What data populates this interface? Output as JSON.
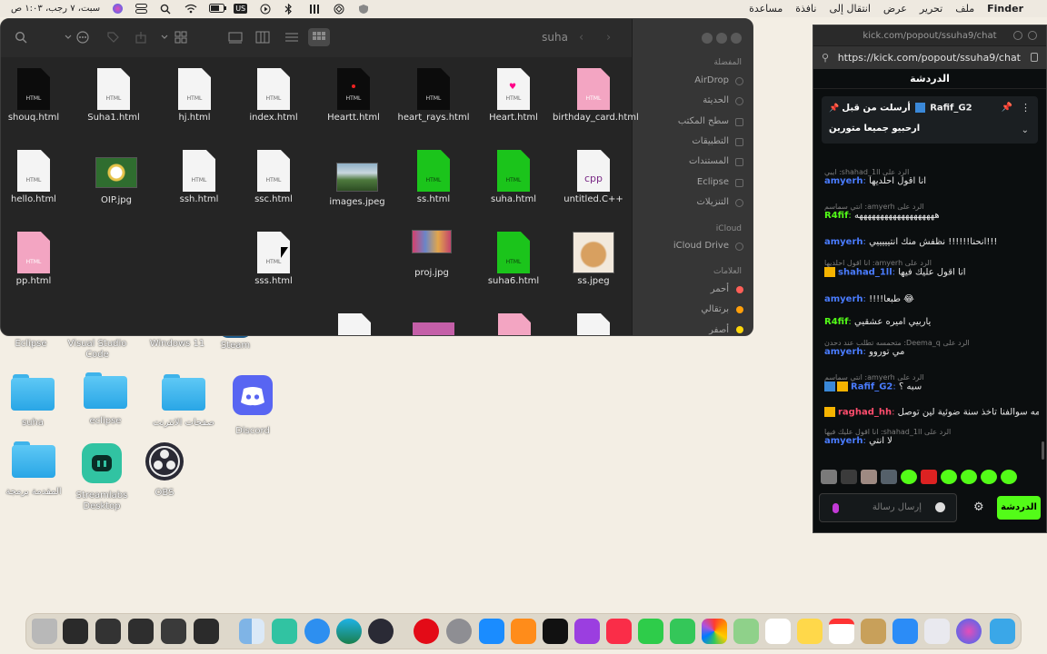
{
  "menubar": {
    "apple": "",
    "items": [
      "Finder",
      "ملف",
      "تحرير",
      "عرض",
      "انتقال إلى",
      "نافذة",
      "مساعدة"
    ],
    "clock": "سبت، ٧ رجب، ١:٠٣ ص",
    "us_badge": "US"
  },
  "desktop": {
    "items": [
      {
        "label": "Eclipse"
      },
      {
        "label": "Visual Studio Code"
      },
      {
        "label": "Windows 11"
      },
      {
        "label": "Steam"
      },
      {
        "label": "suha"
      },
      {
        "label": "eclipse"
      },
      {
        "label": "صفحات الانترنت"
      },
      {
        "label": "Discord"
      },
      {
        "label": "المقدمة برمجة"
      },
      {
        "label": "Streamlabs Desktop"
      },
      {
        "label": "OBS"
      }
    ]
  },
  "finder": {
    "title": "suha",
    "files": [
      {
        "name": "shouq.html",
        "kind": "doc",
        "tag": "HTML",
        "color": "black"
      },
      {
        "name": "Suha1.html",
        "kind": "doc",
        "tag": "HTML",
        "color": "white"
      },
      {
        "name": "hj.html",
        "kind": "doc",
        "tag": "HTML",
        "color": "white"
      },
      {
        "name": "index.html",
        "kind": "doc",
        "tag": "HTML",
        "color": "white"
      },
      {
        "name": "Heartt.html",
        "kind": "doc",
        "tag": "HTML",
        "color": "black"
      },
      {
        "name": "heart_rays.html",
        "kind": "doc",
        "tag": "HTML",
        "color": "black"
      },
      {
        "name": "Heart.html",
        "kind": "doc",
        "tag": "HTML",
        "color": "white"
      },
      {
        "name": "birthday_card.html",
        "kind": "doc",
        "tag": "HTML",
        "color": "pink"
      },
      {
        "name": "hello.html",
        "kind": "doc",
        "tag": "HTML",
        "color": "white"
      },
      {
        "name": "OIP.jpg",
        "kind": "image",
        "color": "white"
      },
      {
        "name": "ssh.html",
        "kind": "doc",
        "tag": "HTML",
        "color": "white"
      },
      {
        "name": "ssc.html",
        "kind": "doc",
        "tag": "HTML",
        "color": "white"
      },
      {
        "name": "images.jpeg",
        "kind": "image",
        "color": "white"
      },
      {
        "name": "ss.html",
        "kind": "doc",
        "tag": "HTML",
        "color": "green"
      },
      {
        "name": "suha.html",
        "kind": "doc",
        "tag": "HTML",
        "color": "green"
      },
      {
        "name": "untitled.C++",
        "kind": "doc",
        "tag": "cpp",
        "color": "white"
      },
      {
        "name": "pp.html",
        "kind": "doc",
        "tag": "HTML",
        "color": "pink"
      },
      {
        "name": "sss.html",
        "kind": "doc",
        "tag": "HTML",
        "color": "white"
      },
      {
        "name": "proj.jpg",
        "kind": "image",
        "color": "white"
      },
      {
        "name": "suha6.html",
        "kind": "doc",
        "tag": "HTML",
        "color": "green"
      },
      {
        "name": "ss.jpeg",
        "kind": "image",
        "color": "white"
      }
    ],
    "sidebar": {
      "favorites_header": "المفضلة",
      "favorites": [
        "AirDrop",
        "الحديثة",
        "سطح المكتب",
        "التطبيقات",
        "المستندات",
        "Eclipse",
        "التنزيلات"
      ],
      "icloud_header": "iCloud",
      "icloud": [
        "iCloud Drive"
      ],
      "tags_header": "العلامات",
      "tags": [
        {
          "label": "أحمر",
          "color": "#ff5f57"
        },
        {
          "label": "برتقالي",
          "color": "#ff9f0a"
        },
        {
          "label": "أصفر",
          "color": "#ffd60a"
        }
      ]
    }
  },
  "chat": {
    "window_title": "kick.com/popout/ssuha9/chat",
    "url": "https://kick.com/popout/ssuha9/chat",
    "header": "الدردشة",
    "pinned": {
      "label": "أرسلت من قبل",
      "user": "Rafif_G2",
      "text": "ارحبيو جميعا متورين"
    },
    "messages": [
      {
        "reply": "الرد على shahad_1ll: ايبي",
        "user": "amyerh",
        "user_color": "#4a7cff",
        "text": "انا اقول احلديها"
      },
      {
        "reply": "الرد على amyerh: انتي سماسم",
        "user": "R4fif",
        "user_color": "#53fc18",
        "text": "هههههههههههههههههههه"
      },
      {
        "reply": "",
        "user": "amyerh",
        "user_color": "#4a7cff",
        "text": "انحنا!!!!!! نظفش منك انتيييييي!!!"
      },
      {
        "reply": "الرد على amyerh: انا اقول احلديها",
        "user": "shahad_1ll",
        "user_color": "#4a7cff",
        "text": "انا اقول عليك فيها"
      },
      {
        "reply": "",
        "user": "amyerh",
        "user_color": "#4a7cff",
        "text": "!!!!طبعا 😂"
      },
      {
        "reply": "",
        "user": "R4fif",
        "user_color": "#53fc18",
        "text": "ياربيي اميره عشقيي"
      },
      {
        "reply": "الرد على Deema_q: متحمسه تطلب عند دحدن",
        "user": "amyerh",
        "user_color": "#4a7cff",
        "text": "مي توروو"
      },
      {
        "reply": "الرد على amyerh: انتي سماسم",
        "user": "Rafif_G2",
        "user_color": "#4a7cff",
        "text": "سبه ؟"
      },
      {
        "reply": "",
        "user": "raghad_hh",
        "user_color": "#ff4d6d",
        "text": "يمه سوالفنا تاخذ سنة ضوئية لين توصل"
      },
      {
        "reply": "الرد على shahad_1ll: انا اقول عليك فيها",
        "user": "amyerh",
        "user_color": "#4a7cff",
        "text": "لا انتي"
      }
    ],
    "input_placeholder": "إرسال رسالة",
    "send_label": "الدردشة"
  }
}
